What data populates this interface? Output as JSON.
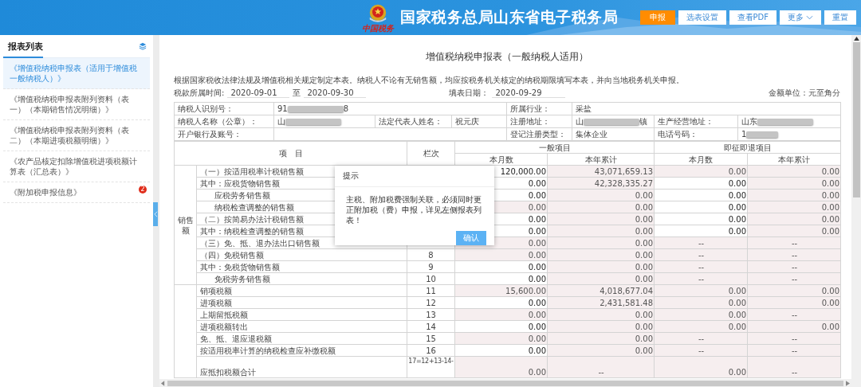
{
  "header": {
    "emblem_caption": "中国税务",
    "title": "国家税务总局山东省电子税务局",
    "buttons": [
      {
        "label": "申报",
        "kind": "primary"
      },
      {
        "label": "选表设置",
        "kind": "plain"
      },
      {
        "label": "查看PDF",
        "kind": "plain"
      },
      {
        "label": "更多",
        "kind": "menu"
      },
      {
        "label": "重置",
        "kind": "plain"
      }
    ]
  },
  "sidebar": {
    "title": "报表列表",
    "items": [
      {
        "label": "《增值税纳税申报表（适用于增值税一般纳税人）》",
        "selected": true
      },
      {
        "label": "《增值税纳税申报表附列资料（表一）（本期销售情况明细）》",
        "selected": false
      },
      {
        "label": "《增值税纳税申报表附列资料（表二）（本期进项税额明细）》",
        "selected": false
      },
      {
        "label": "《农产品核定扣除增值税进项税额计算表（汇总表）》",
        "selected": false
      },
      {
        "label": "《附加税申报信息》",
        "selected": false,
        "badge": "2"
      }
    ]
  },
  "form": {
    "title": "增值税纳税申报表（一般纳税人适用）",
    "intro": "根据国家税收法律法规及增值税相关规定制定本表。纳税人不论有无销售额，均应按税务机关核定的纳税期限填写本表，并向当地税务机关申报。",
    "period_label": "税款所属时间:",
    "period_start": "2020-09-01",
    "period_to": "至",
    "period_end": "2020-09-30",
    "fill_date_label": "填表日期：",
    "fill_date": "2020-09-29",
    "unit": "金额单位：元至角分",
    "taxpayer": {
      "id": {
        "label": "纳税人识别号：",
        "value": "91",
        "tail": "8"
      },
      "industry": {
        "label": "所属行业：",
        "value": "采盐"
      },
      "name": {
        "label": "纳税人名称（公章）：",
        "value": "山"
      },
      "legal_rep": {
        "label": "法定代表人姓名：",
        "value": "祝元庆"
      },
      "reg_address": {
        "label": "注册地址：",
        "value": "山",
        "tail": "镇"
      },
      "business_address": {
        "label": "生产经营地址：",
        "value": "山东"
      },
      "bank": {
        "label": "开户银行及账号："
      },
      "reg_type": {
        "label": "登记注册类型：",
        "value": "集体企业"
      },
      "phone": {
        "label": "电话号码：",
        "value": "1"
      }
    },
    "table": {
      "item_header": "项　目",
      "line_header": "栏次",
      "general_header": "一般项目",
      "refund_header": "即征即退项目",
      "sub_headers": [
        "本月数",
        "本年累计",
        "本月数",
        "本年累计"
      ],
      "groups": [
        {
          "label": "销售额",
          "rows": [
            {
              "kind": "item",
              "label": "（一）按适用税率计税销售额",
              "cells": [
                {
                  "v": "120,000.00",
                  "editable": true
                },
                {
                  "v": "43,071,659.13",
                  "editable": false
                },
                {
                  "v": "0.00",
                  "editable": false
                },
                {
                  "v": "0.00",
                  "editable": false
                }
              ]
            },
            {
              "kind": "item",
              "label": "其中：应税货物销售额",
              "cells": [
                {
                  "v": "0.00",
                  "editable": true
                },
                {
                  "v": "42,328,335.27",
                  "editable": false
                },
                {
                  "v": "0.00",
                  "editable": true
                },
                {
                  "v": "0.00",
                  "editable": false
                }
              ]
            },
            {
              "kind": "sub",
              "label": "应税劳务销售额",
              "cells": [
                {
                  "v": "0.00",
                  "editable": true
                },
                {
                  "v": "0.00",
                  "editable": false
                },
                {
                  "v": "0.00",
                  "editable": true
                },
                {
                  "v": "0.00",
                  "editable": false
                }
              ]
            },
            {
              "kind": "sub",
              "label": "纳税检查调整的销售额",
              "cells": [
                {
                  "v": "0.00",
                  "editable": false
                },
                {
                  "v": "0.00",
                  "editable": false
                },
                {
                  "v": "0.00",
                  "editable": true
                },
                {
                  "v": "0.00",
                  "editable": false
                }
              ]
            },
            {
              "kind": "item",
              "label": "（二）按简易办法计税销售额",
              "cells": [
                {
                  "v": "0.00",
                  "editable": true
                },
                {
                  "v": "0.00",
                  "editable": false
                },
                {
                  "v": "0.00",
                  "editable": true
                },
                {
                  "v": "0.00",
                  "editable": false
                }
              ]
            },
            {
              "kind": "item",
              "label": "其中：纳税检查调整的销售额",
              "cells": [
                {
                  "v": "0.00",
                  "editable": true
                },
                {
                  "v": "0.00",
                  "editable": false
                },
                {
                  "v": "0.00",
                  "editable": true
                },
                {
                  "v": "0.00",
                  "editable": false
                }
              ]
            },
            {
              "kind": "item",
              "label": "（三）免、抵、退办法出口销售额",
              "cells": [
                {
                  "v": "0.00",
                  "editable": false
                },
                {
                  "v": "0.00",
                  "editable": false
                },
                {
                  "v": "--",
                  "editable": false
                },
                {
                  "v": "--",
                  "editable": false
                }
              ]
            },
            {
              "kind": "item",
              "label": "（四）免税销售额",
              "line": "8",
              "cells": [
                {
                  "v": "0.00",
                  "editable": false
                },
                {
                  "v": "0.00",
                  "editable": false
                },
                {
                  "v": "--",
                  "editable": false
                },
                {
                  "v": "--",
                  "editable": false
                }
              ]
            },
            {
              "kind": "item",
              "label": "其中：免税货物销售额",
              "line": "9",
              "cells": [
                {
                  "v": "0.00",
                  "editable": true
                },
                {
                  "v": "0.00",
                  "editable": false
                },
                {
                  "v": "--",
                  "editable": false
                },
                {
                  "v": "--",
                  "editable": false
                }
              ]
            },
            {
              "kind": "sub",
              "label": "免税劳务销售额",
              "line": "10",
              "cells": [
                {
                  "v": "0.00",
                  "editable": true
                },
                {
                  "v": "0.00",
                  "editable": false
                },
                {
                  "v": "--",
                  "editable": false
                },
                {
                  "v": "--",
                  "editable": false
                }
              ]
            }
          ]
        },
        {
          "rows": [
            {
              "kind": "item",
              "label": "销项税额",
              "line": "11",
              "cells": [
                {
                  "v": "15,600.00",
                  "editable": false
                },
                {
                  "v": "4,018,677.04",
                  "editable": false
                },
                {
                  "v": "0.00",
                  "editable": false
                },
                {
                  "v": "0.00",
                  "editable": false
                }
              ]
            },
            {
              "kind": "item",
              "label": "进项税额",
              "line": "12",
              "cells": [
                {
                  "v": "0.00",
                  "editable": true
                },
                {
                  "v": "2,431,581.48",
                  "editable": false
                },
                {
                  "v": "0.00",
                  "editable": false
                },
                {
                  "v": "0.00",
                  "editable": false
                }
              ]
            },
            {
              "kind": "item",
              "label": "上期留抵税额",
              "line": "13",
              "cells": [
                {
                  "v": "0.00",
                  "editable": false
                },
                {
                  "v": "0.00",
                  "editable": false
                },
                {
                  "v": "0.00",
                  "editable": false
                },
                {
                  "v": "--",
                  "editable": false
                }
              ]
            },
            {
              "kind": "item",
              "label": "进项税额转出",
              "line": "14",
              "cells": [
                {
                  "v": "0.00",
                  "editable": true
                },
                {
                  "v": "0.00",
                  "editable": false
                },
                {
                  "v": "0.00",
                  "editable": false
                },
                {
                  "v": "0.00",
                  "editable": false
                }
              ]
            },
            {
              "kind": "item",
              "label": "免、抵、退应退税额",
              "line": "15",
              "cells": [
                {
                  "v": "0.00",
                  "editable": false
                },
                {
                  "v": "0.00",
                  "editable": false
                },
                {
                  "v": "--",
                  "editable": false
                },
                {
                  "v": "--",
                  "editable": false
                }
              ]
            },
            {
              "kind": "item",
              "label": "按适用税率计算的纳税检查应补缴税额",
              "line": "16",
              "cells": [
                {
                  "v": "0.00",
                  "editable": true
                },
                {
                  "v": "0.00",
                  "editable": false
                },
                {
                  "v": "--",
                  "editable": false
                },
                {
                  "v": "--",
                  "editable": false
                }
              ]
            },
            {
              "kind": "tall",
              "label": "应抵扣税额合计",
              "line": "17=12+13-14-",
              "cells": [
                {
                  "v": "0.00",
                  "editable": false
                },
                {
                  "v": "--",
                  "editable": false
                },
                {
                  "v": "0.00",
                  "editable": false
                },
                {
                  "v": "--",
                  "editable": false
                }
              ]
            }
          ]
        }
      ]
    }
  },
  "dialog": {
    "title": "提示",
    "message": "主税、附加税费强制关联，必须同时更正附加税（费）申报，详见左侧报表列表！",
    "button": "确认"
  }
}
